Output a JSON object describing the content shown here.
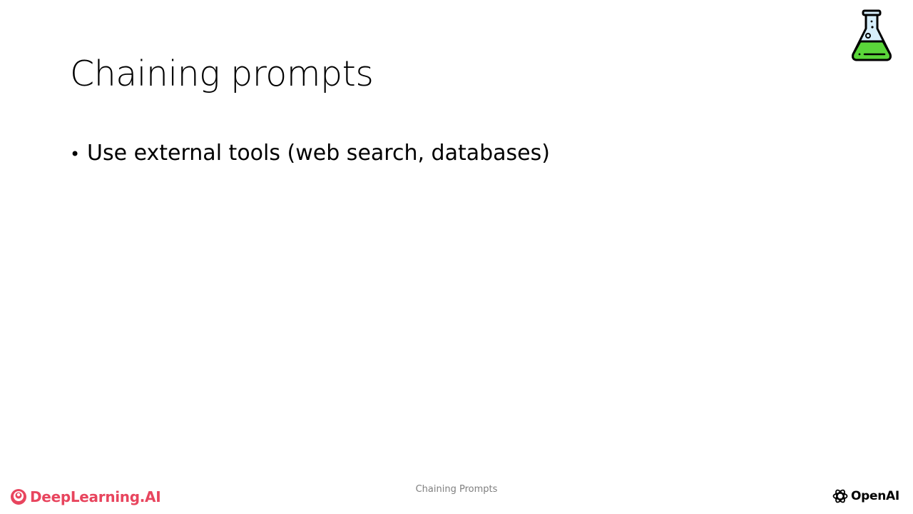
{
  "slide": {
    "title": "Chaining prompts",
    "bullets": [
      {
        "text": "Use external tools (web search, databases)"
      }
    ],
    "footer_center": "Chaining Prompts",
    "logo_left": "DeepLearning.AI",
    "logo_right": "OpenAI",
    "flask_icon": "flask-icon"
  },
  "colors": {
    "brand_deeplearning": "#e8455e",
    "flask_liquid": "#5ad63a",
    "flask_glass": "#d6eefb",
    "footer_text": "#7f7f7f"
  }
}
